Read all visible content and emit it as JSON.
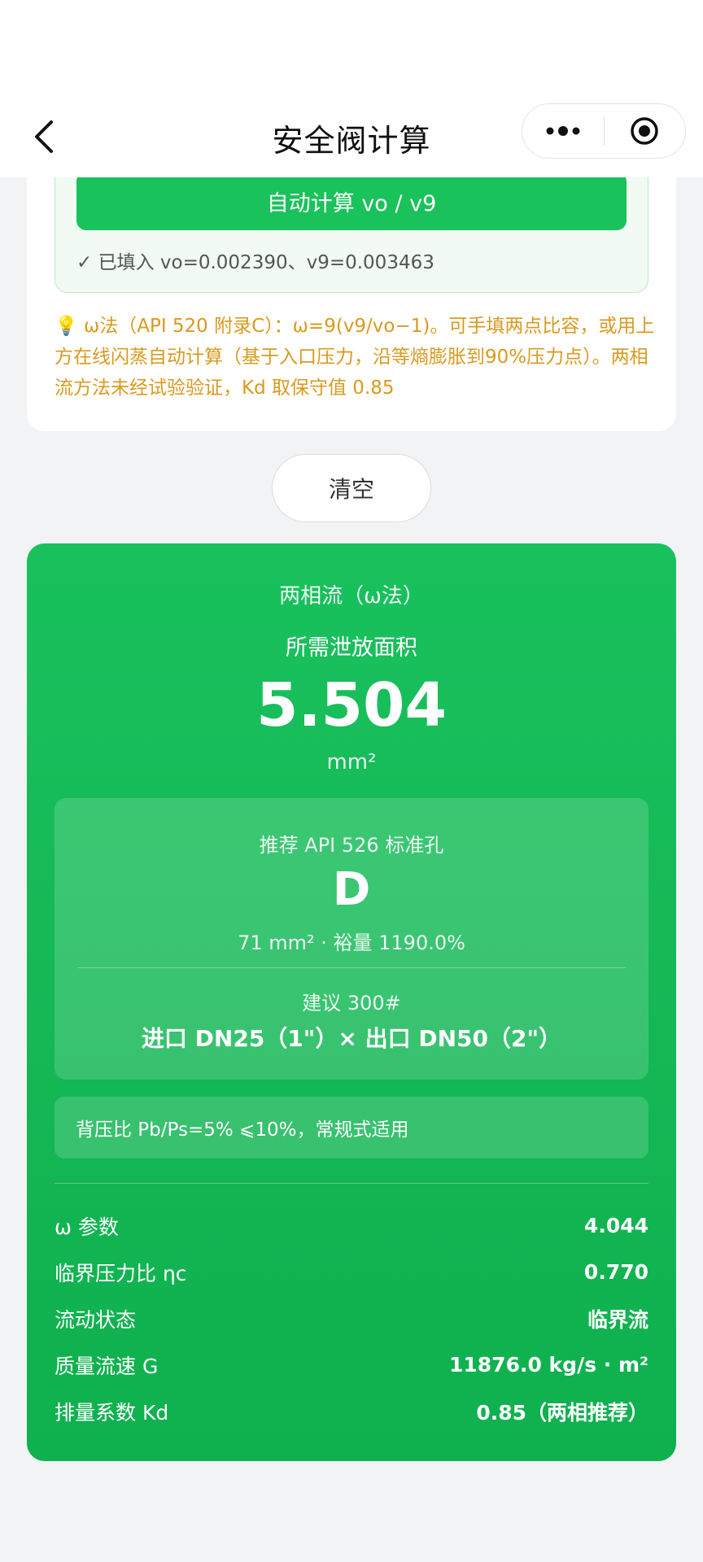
{
  "nav": {
    "title": "安全阀计算"
  },
  "flash": {
    "auto_button": "自动计算 vo / v9",
    "filled": "✓ 已填入 vo=0.002390、v9=0.003463"
  },
  "hint": "💡 ω法（API 520 附录C）：ω=9(v9/vo−1)。可手填两点比容，或用上方在线闪蒸自动计算（基于入口压力，沿等熵膨胀到90%压力点）。两相流方法未经试验验证，Kd 取保守值 0.85",
  "clear_button": "清空",
  "result": {
    "method": "两相流（ω法）",
    "area_label": "所需泄放面积",
    "area_value": "5.504",
    "area_unit": "mm²",
    "orifice_label": "推荐 API 526 标准孔",
    "orifice_letter": "D",
    "orifice_sub": "71 mm² · 裕量 1190.0%",
    "class_label": "建议 300#",
    "size_label": "进口 DN25（1\"）× 出口 DN50（2\"）",
    "backpressure": "背压比 Pb/Ps=5% ⩽10%，常规式适用",
    "params": [
      {
        "label": "ω 参数",
        "value": "4.044"
      },
      {
        "label": "临界压力比 ηc",
        "value": "0.770"
      },
      {
        "label": "流动状态",
        "value": "临界流"
      },
      {
        "label": "质量流速 G",
        "value": "11876.0 kg/s · m²"
      },
      {
        "label": "排量系数 Kd",
        "value": "0.85（两相推荐）"
      }
    ]
  }
}
